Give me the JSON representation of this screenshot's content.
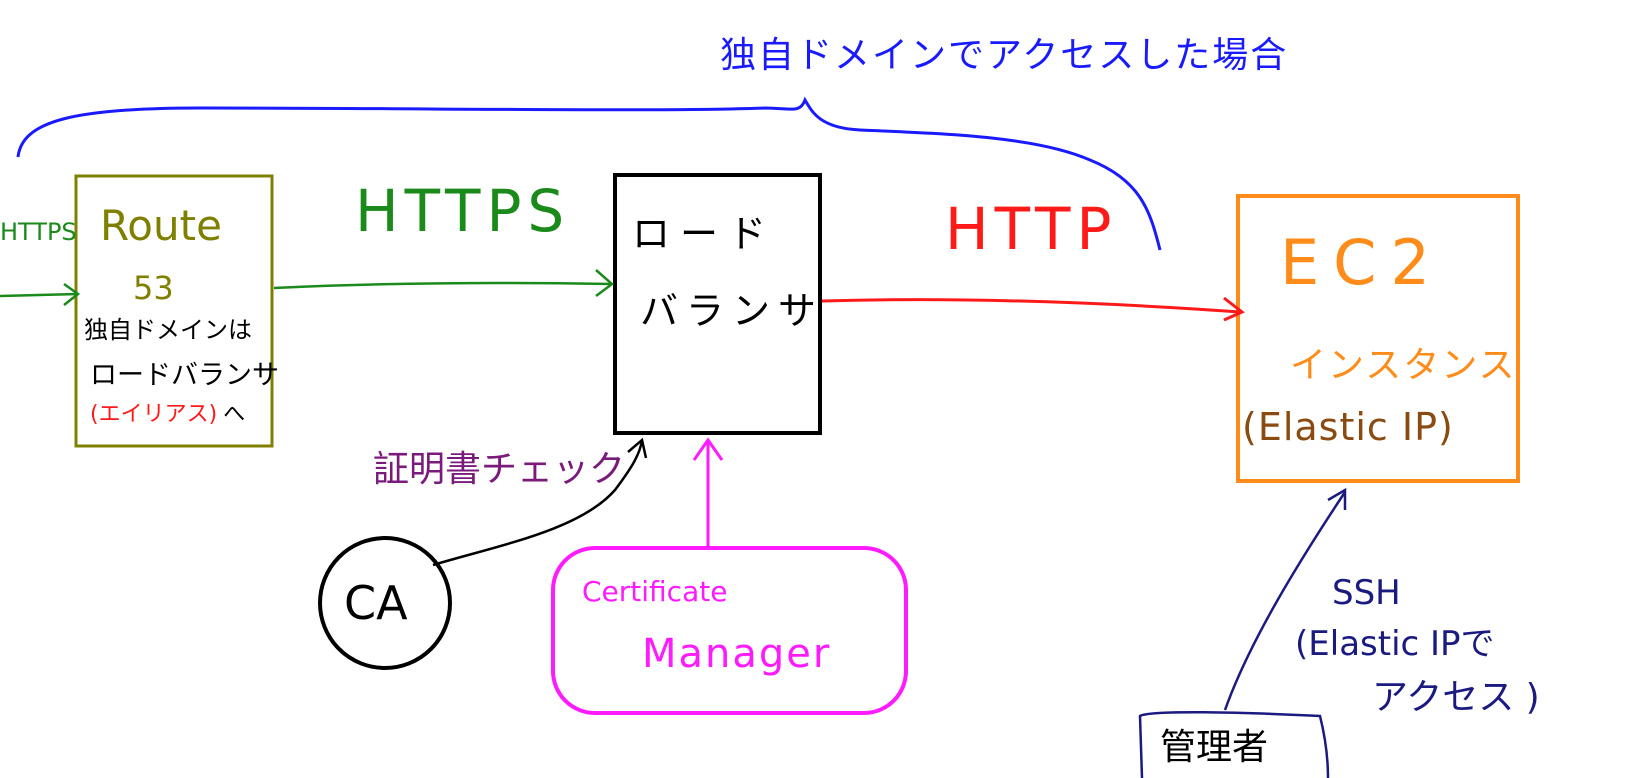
{
  "title": "独自ドメインでアクセスした場合",
  "colors": {
    "brace": "#1a1aff",
    "route53": "#808000",
    "https": "#1a8a1a",
    "http": "#ff1a1a",
    "ec2": "#ff8c1a",
    "elastic_ip": "#8a4a10",
    "cert_check": "#7a1a7a",
    "acm": "#ff1aff",
    "admin": "#1a1a80",
    "black": "#000000"
  },
  "nodes": {
    "route53": {
      "name_line1": "Route",
      "name_line2": "53",
      "note_line1": "独自ドメインは",
      "note_line2": "ロードバランサ",
      "note_alias": "(エイリアス)",
      "note_suffix": "へ"
    },
    "load_balancer": {
      "line1": "ロード",
      "line2": "バランサ"
    },
    "ec2": {
      "line1": "EC2",
      "line2": "インスタンス",
      "line3": "(Elastic IP)"
    },
    "ca": {
      "label": "CA"
    },
    "acm": {
      "line1": "Certificate",
      "line2": "Manager"
    },
    "admin": {
      "label": "管理者"
    }
  },
  "edges": {
    "incoming": "HTTPS",
    "route_to_lb": "HTTPS",
    "lb_to_ec2": "HTTP",
    "ca_to_lb": "証明書チェック",
    "admin_to_ec2_line1": "SSH",
    "admin_to_ec2_line2": "(Elastic IPで",
    "admin_to_ec2_line3": "アクセス )"
  }
}
